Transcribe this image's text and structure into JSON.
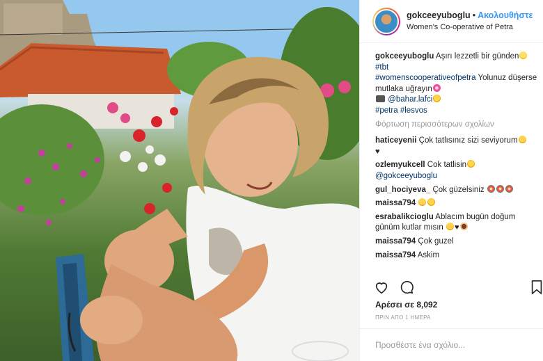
{
  "post": {
    "username": "gokceeyuboglu",
    "follow_label": "Ακολουθήστε",
    "dot": "•",
    "location": "Women's Co-operative of Petra"
  },
  "caption": {
    "username": "gokceeyuboglu",
    "text1": "Aşırı lezzetli bir günden",
    "tag1": "#tbt",
    "tag2": "#womenscooperativeofpetra",
    "text2": "Yolunuz düşerse mutlaka uğrayın",
    "mention": "@bahar.lafci",
    "tag3": "#petra",
    "tag4": "#lesvos"
  },
  "load_more": "Φόρτωση περισσότερων σχολίων",
  "comments": [
    {
      "user": "haticeyenii",
      "text": "Çok tatlısınız sizi seviyorum"
    },
    {
      "user": "ozlemyukcell",
      "text": "Cok tatlisin",
      "mention": "@gokceeyuboglu"
    },
    {
      "user": "gul_hociyeva_",
      "text": "Çok güzelsiniz"
    },
    {
      "user": "maissa794",
      "text": ""
    },
    {
      "user": "esrabalikcioglu",
      "text": "Ablacım bugün doğum günüm kutlar mısın"
    },
    {
      "user": "maissa794",
      "text": "Çok guzel"
    },
    {
      "user": "maissa794",
      "text": "Askim"
    }
  ],
  "likes": "Αρέσει σε 8,092",
  "timestamp": "ΠΡΙΝ ΑΠΟ 1 ΗΜΕΡΑ",
  "add_comment_placeholder": "Προσθέστε ένα σχόλιο...",
  "icons": {
    "like": "heart-icon",
    "comment": "comment-icon",
    "save": "bookmark-icon"
  },
  "colors": {
    "follow": "#3897f0",
    "hashtag": "#003569",
    "muted": "#999999"
  }
}
